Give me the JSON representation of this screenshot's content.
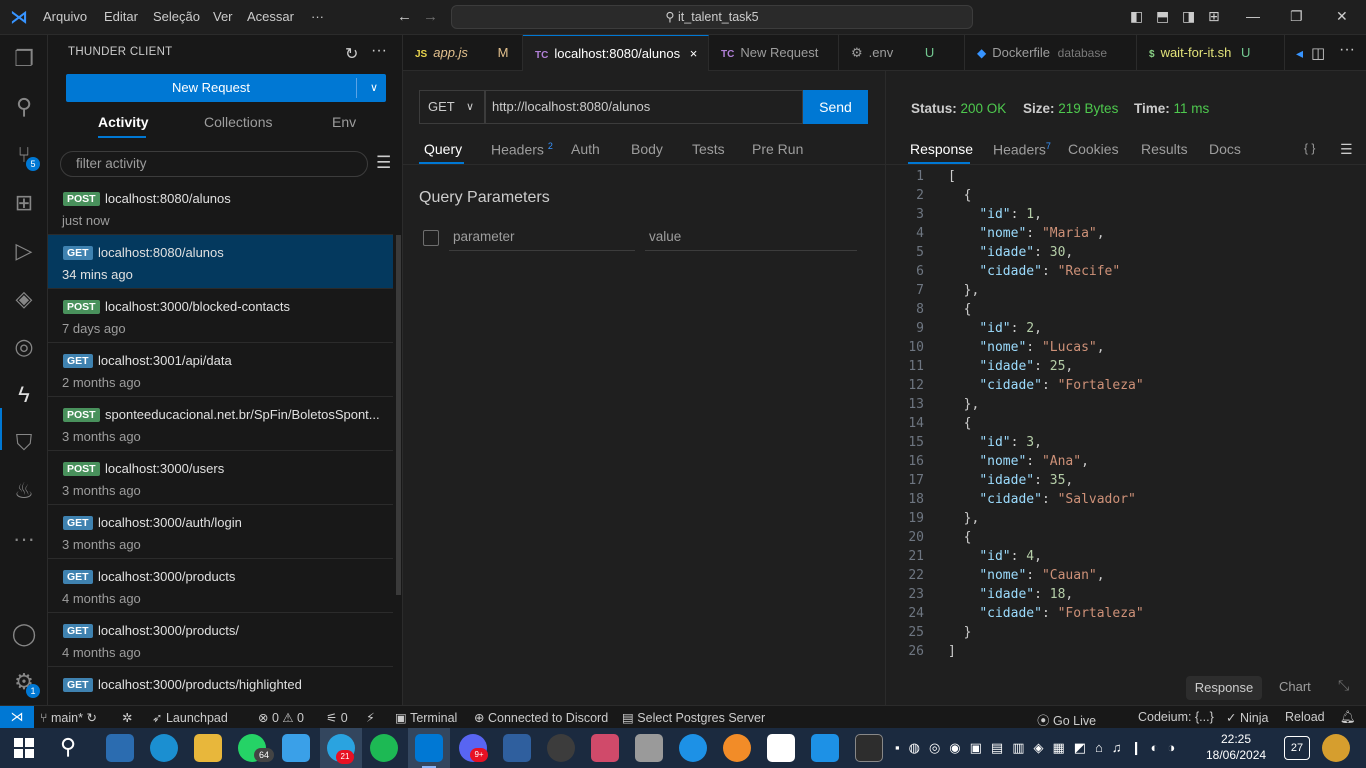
{
  "titlebar": {
    "menu": [
      "Arquivo",
      "Editar",
      "Seleção",
      "Ver",
      "Acessar",
      "···"
    ],
    "search": "it_talent_task5"
  },
  "activity_bar": {
    "source_control_badge": "5",
    "settings_badge": "1"
  },
  "sidebar": {
    "title": "THUNDER CLIENT",
    "new_request": "New Request",
    "tabs": [
      "Activity",
      "Collections",
      "Env"
    ],
    "filter_placeholder": "filter activity",
    "items": [
      {
        "method": "POST",
        "url": "localhost:8080/alunos",
        "time": "just now"
      },
      {
        "method": "GET",
        "url": "localhost:8080/alunos",
        "time": "34 mins ago"
      },
      {
        "method": "POST",
        "url": "localhost:3000/blocked-contacts",
        "time": "7 days ago"
      },
      {
        "method": "GET",
        "url": "localhost:3001/api/data",
        "time": "2 months ago"
      },
      {
        "method": "POST",
        "url": "sponteeducacional.net.br/SpFin/BoletosSpont...",
        "time": "3 months ago"
      },
      {
        "method": "POST",
        "url": "localhost:3000/users",
        "time": "3 months ago"
      },
      {
        "method": "GET",
        "url": "localhost:3000/auth/login",
        "time": "3 months ago"
      },
      {
        "method": "GET",
        "url": "localhost:3000/products",
        "time": "4 months ago"
      },
      {
        "method": "GET",
        "url": "localhost:3000/products/",
        "time": "4 months ago"
      },
      {
        "method": "GET",
        "url": "localhost:3000/products/highlighted",
        "time": ""
      }
    ]
  },
  "tabs": [
    {
      "icon": "JS",
      "label": "app.js",
      "suffix": "M"
    },
    {
      "icon": "TC",
      "label": "localhost:8080/alunos",
      "suffix": "×"
    },
    {
      "icon": "TC",
      "label": "New Request",
      "suffix": ""
    },
    {
      "icon": "⚙",
      "label": ".env",
      "suffix": "U"
    },
    {
      "icon": "◆",
      "label": "Dockerfile",
      "suffix": "database"
    },
    {
      "icon": "$",
      "label": "wait-for-it.sh",
      "suffix": "U"
    }
  ],
  "request": {
    "method": "GET",
    "url": "http://localhost:8080/alunos",
    "send": "Send",
    "tabs": [
      "Query",
      "Headers",
      "Auth",
      "Body",
      "Tests",
      "Pre Run"
    ],
    "headers_count": "2",
    "query_title": "Query Parameters",
    "param_placeholder": "parameter",
    "value_placeholder": "value"
  },
  "response": {
    "status_label": "Status:",
    "status": "200 OK",
    "size_label": "Size:",
    "size": "219 Bytes",
    "time_label": "Time:",
    "time": "11 ms",
    "tabs": [
      "Response",
      "Headers",
      "Cookies",
      "Results",
      "Docs"
    ],
    "headers_count": "7",
    "braces": "{ }",
    "body": [
      {
        "id": 1,
        "nome": "Maria",
        "idade": 30,
        "cidade": "Recife"
      },
      {
        "id": 2,
        "nome": "Lucas",
        "idade": 25,
        "cidade": "Fortaleza"
      },
      {
        "id": 3,
        "nome": "Ana",
        "idade": 35,
        "cidade": "Salvador"
      },
      {
        "id": 4,
        "nome": "Cauan",
        "idade": 18,
        "cidade": "Fortaleza"
      }
    ],
    "footer": [
      "Response",
      "Chart"
    ]
  },
  "statusbar": {
    "branch": "main*",
    "launchpad": "Launchpad",
    "problems": "⊗ 0 ⚠ 0",
    "ports": "0",
    "terminal": "Terminal",
    "discord": "Connected to Discord",
    "postgres": "Select Postgres Server",
    "golive": "Go Live",
    "codeium": "Codeium: {...}",
    "ninja": "Ninja",
    "reload": "Reload"
  },
  "taskbar": {
    "whatsapp_badge": "64",
    "telegram_badge": "21",
    "discord_badge": "9+",
    "notif_badge": "27",
    "time": "22:25",
    "date": "18/06/2024"
  }
}
